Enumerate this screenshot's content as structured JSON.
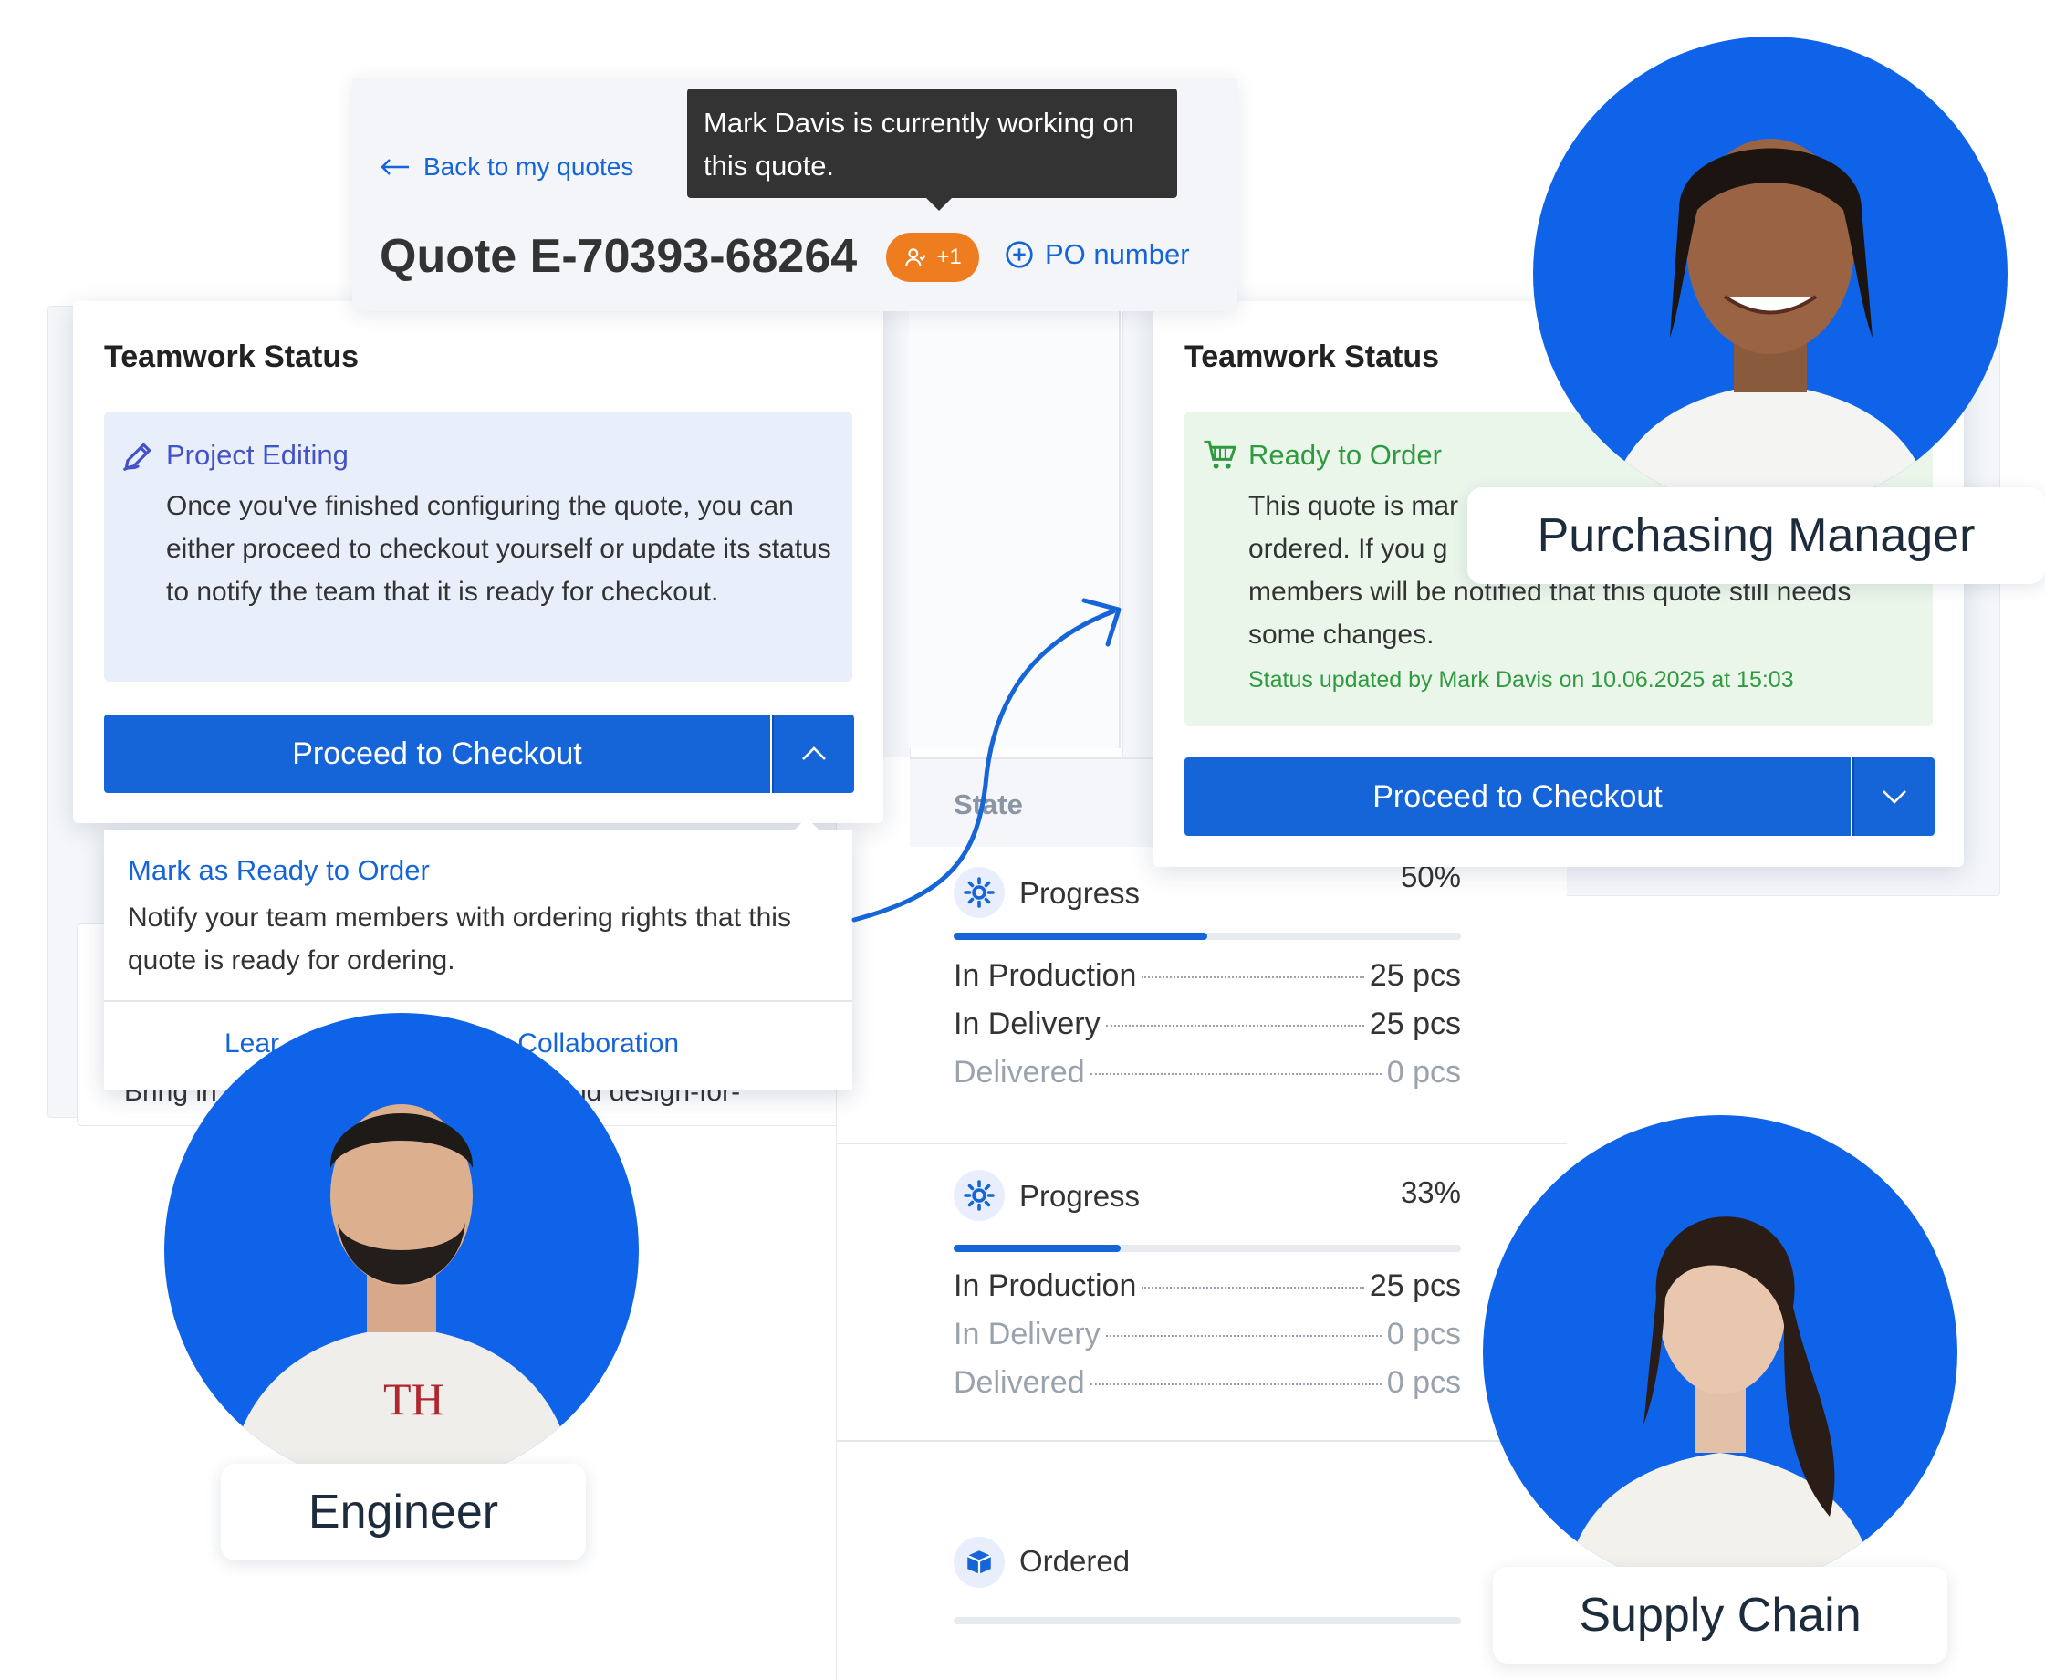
{
  "header": {
    "back_label": "Back to my quotes",
    "quote_title": "Quote E-70393-68264",
    "users_badge": "+1",
    "po_label": "PO number",
    "tooltip": "Mark Davis is currently working on this quote."
  },
  "left_card": {
    "title": "Teamwork Status",
    "status_title": "Project Editing",
    "status_body": "Once you've finished configuring the quote, you can either proceed to checkout yourself or update its status to notify the team that it is ready for checkout.",
    "button_label": "Proceed to Checkout",
    "dropdown": {
      "item_title": "Mark as Ready to Order",
      "item_body": "Notify your team members with ordering rights that this quote is ready for ordering.",
      "learn_prefix": "Lear",
      "learn_suffix": "m Collaboration"
    },
    "bg_text_left": "Bring in",
    "bg_text_right": "nd design-for-"
  },
  "right_card": {
    "title": "Teamwork Status",
    "status_title": "Ready to Order",
    "status_body_line1": "This quote is mar",
    "status_body_line2": "ordered. If you g",
    "status_body_line3": "members will be notified that this quote still needs",
    "status_body_line4": "some changes.",
    "status_stamp": "Status updated by Mark Davis on 10.06.2025 at 15:03",
    "button_label": "Proceed to Checkout"
  },
  "state_table": {
    "column_label": "State",
    "groups": [
      {
        "title": "Progress",
        "percent_label": "50%",
        "percent": 0.5,
        "rows": [
          {
            "label": "In Production",
            "value": "25 pcs",
            "dim": false
          },
          {
            "label": "In Delivery",
            "value": "25 pcs",
            "dim": false
          },
          {
            "label": "Delivered",
            "value": "0 pcs",
            "dim": true
          }
        ]
      },
      {
        "title": "Progress",
        "percent_label": "33%",
        "percent": 0.33,
        "rows": [
          {
            "label": "In Production",
            "value": "25 pcs",
            "dim": false
          },
          {
            "label": "In Delivery",
            "value": "0 pcs",
            "dim": true
          },
          {
            "label": "Delivered",
            "value": "0 pcs",
            "dim": true
          }
        ]
      }
    ],
    "ordered_label": "Ordered"
  },
  "roles": {
    "engineer": "Engineer",
    "purchasing": "Purchasing Manager",
    "supply": "Supply Chain"
  },
  "colors": {
    "accent": "#1565d8",
    "badge": "#ee7d1f",
    "success": "#2f9a3f",
    "editing": "#4352c7",
    "avatar_bg": "#0f63e8"
  }
}
